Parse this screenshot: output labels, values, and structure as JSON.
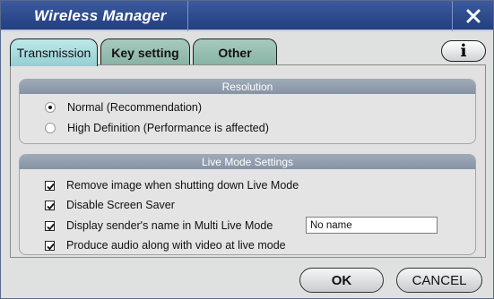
{
  "window": {
    "title": "Wireless Manager",
    "close_icon": "close-icon"
  },
  "tabs": [
    {
      "label": "Transmission",
      "active": true
    },
    {
      "label": "Key setting",
      "active": false
    },
    {
      "label": "Other",
      "active": false
    }
  ],
  "info_button": {
    "label": "i",
    "icon": "info-icon"
  },
  "resolution": {
    "header": "Resolution",
    "options": [
      {
        "label": "Normal (Recommendation)",
        "selected": true
      },
      {
        "label": "High Definition (Performance is affected)",
        "selected": false
      }
    ]
  },
  "live_mode": {
    "header": "Live Mode Settings",
    "options": [
      {
        "label": "Remove image when shutting down Live Mode",
        "checked": true
      },
      {
        "label": "Disable Screen Saver",
        "checked": true
      },
      {
        "label": "Display sender's name in Multi Live Mode",
        "checked": true
      },
      {
        "label": "Produce audio along with video at live mode",
        "checked": true
      }
    ],
    "sender_name": "No name"
  },
  "buttons": {
    "ok": "OK",
    "cancel": "CANCEL"
  },
  "colors": {
    "titlebar": "#223f80",
    "tab_active": "#94cfd3",
    "tab_inactive": "#87b3a4",
    "group_header": "#8693a5"
  }
}
